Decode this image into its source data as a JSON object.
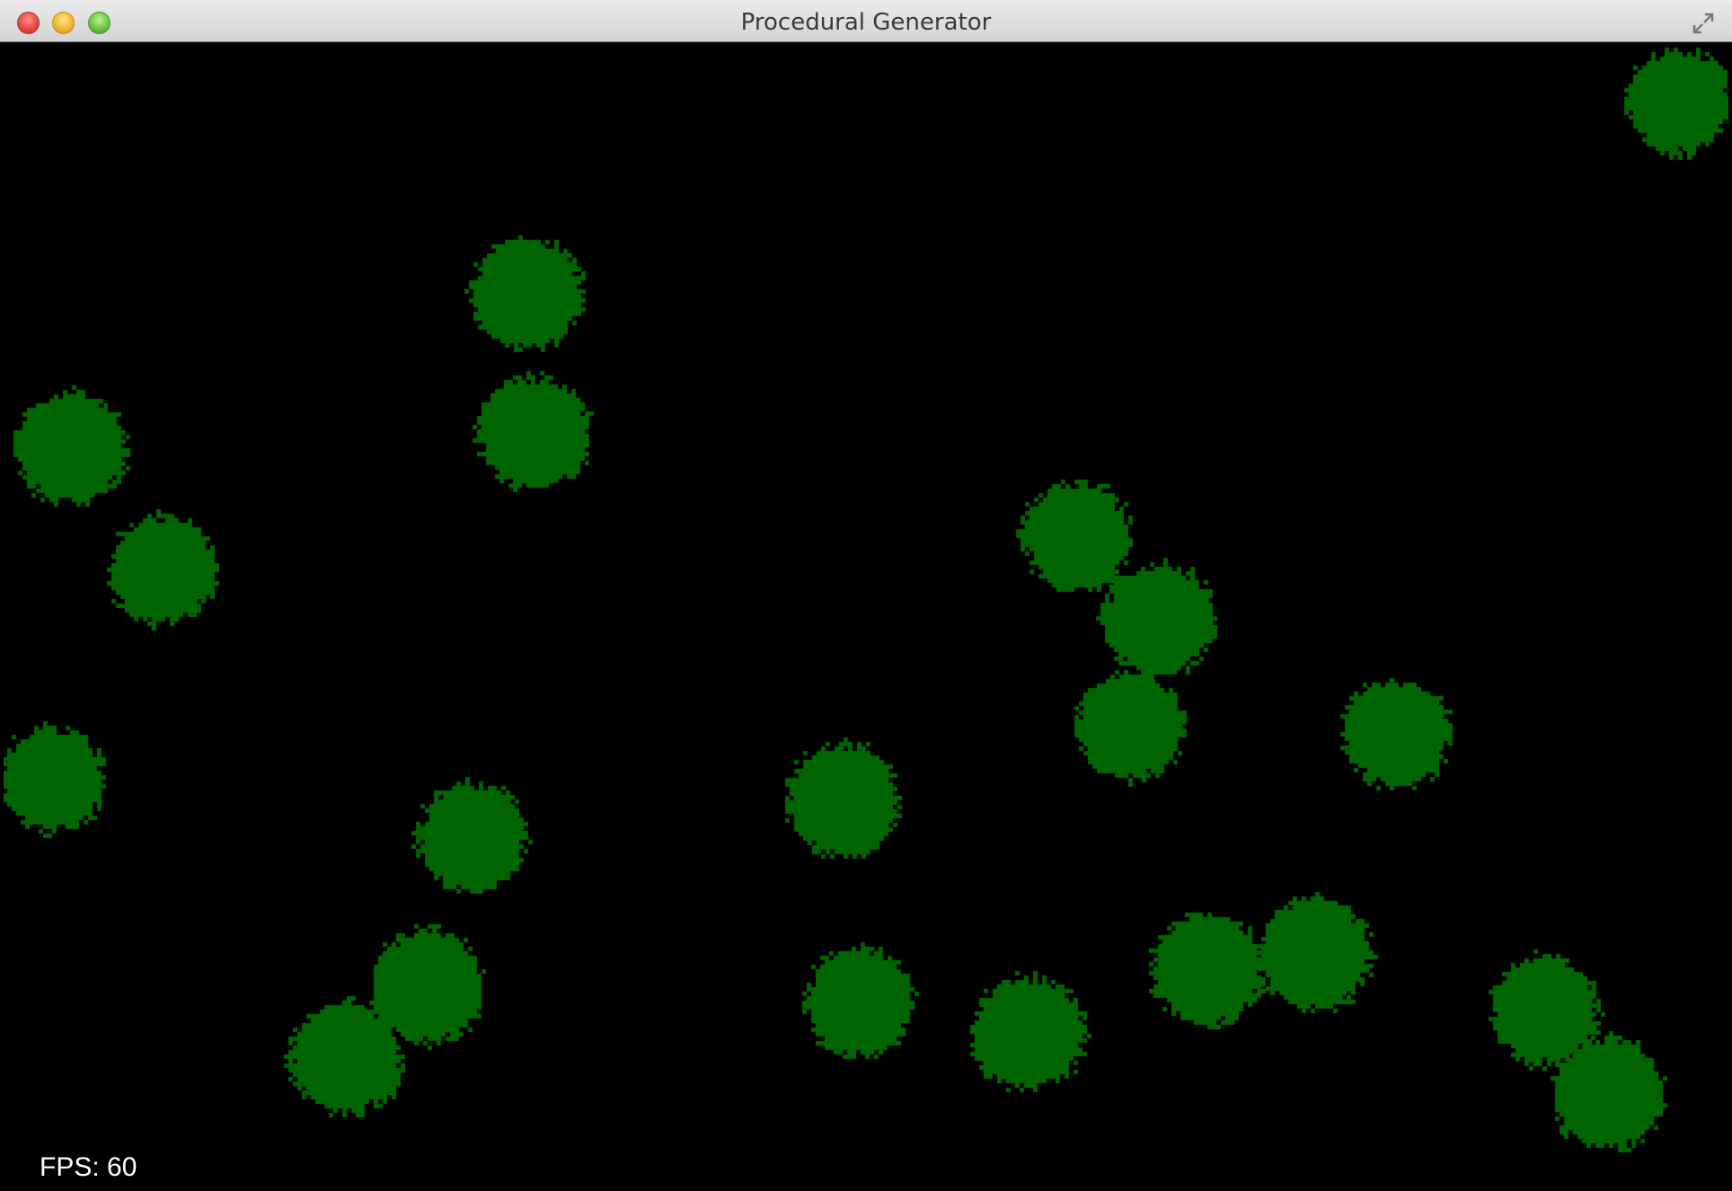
{
  "window": {
    "title": "Procedural Generator"
  },
  "hud": {
    "fps_label": "FPS: 60"
  },
  "colors": {
    "background": "#000000",
    "blob": "#006400"
  },
  "icons": [
    "close-button",
    "minimize-button",
    "zoom-button",
    "fullscreen-icon"
  ]
}
